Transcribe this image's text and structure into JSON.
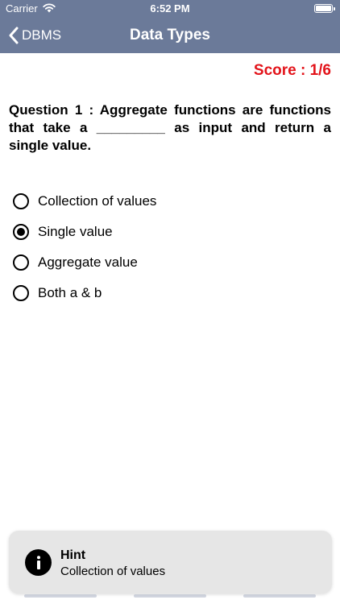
{
  "status_bar": {
    "carrier": "Carrier",
    "time": "6:52 PM",
    "battery_level": 1.0,
    "icons": [
      "wifi-icon",
      "battery-icon"
    ]
  },
  "nav": {
    "back_label": "DBMS",
    "back_icon": "chevron-left-icon",
    "title": "Data Types"
  },
  "score": {
    "text": "Score : 1/6"
  },
  "question": {
    "text": "Question 1 : Aggregate functions are functions that take a _________ as input and return a single value."
  },
  "options": [
    {
      "label": "Collection of values",
      "selected": false
    },
    {
      "label": "Single value",
      "selected": true
    },
    {
      "label": "Aggregate value",
      "selected": false
    },
    {
      "label": "Both a & b",
      "selected": false
    }
  ],
  "hint": {
    "icon": "info-icon",
    "title": "Hint",
    "text": "Collection of values"
  },
  "colors": {
    "nav_background": "#6b7a99",
    "score": "#e3141b",
    "hint_card": "#e6e6e6"
  }
}
